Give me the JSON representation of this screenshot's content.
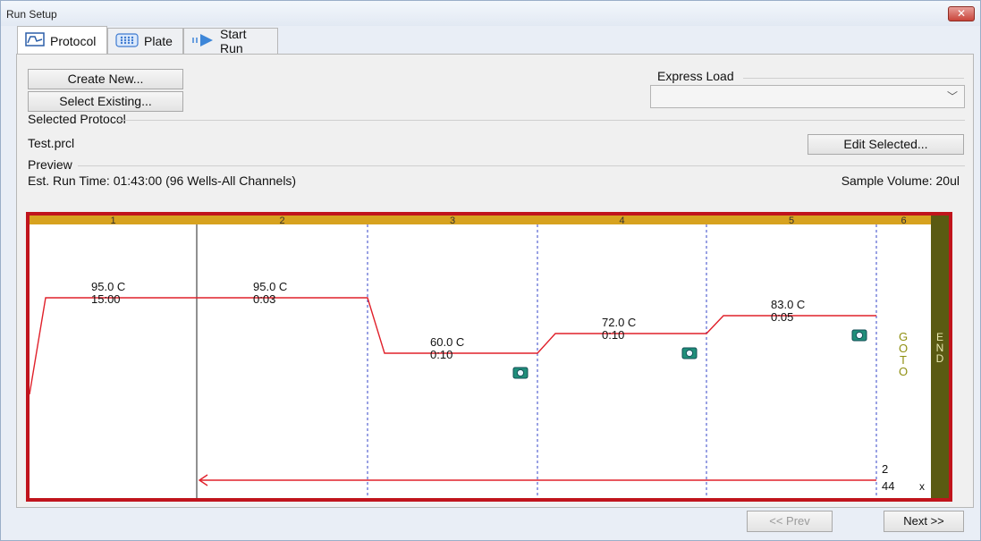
{
  "window": {
    "title": "Run Setup",
    "close_symbol": "✕"
  },
  "tabs": [
    {
      "label": "Protocol",
      "icon": "protocol-graph-icon",
      "selected": true
    },
    {
      "label": "Plate",
      "icon": "plate-grid-icon",
      "selected": false
    },
    {
      "label": "Start Run",
      "icon": "play-arrow-icon",
      "selected": false
    }
  ],
  "actions": {
    "create_new": "Create New...",
    "select_existing": "Select Existing...",
    "edit_selected": "Edit Selected..."
  },
  "express_load": {
    "label": "Express Load",
    "value": ""
  },
  "selected_protocol": {
    "label": "Selected Protocol",
    "name": "Test.prcl"
  },
  "preview": {
    "label": "Preview",
    "run_time": "Est. Run Time: 01:43:00  (96 Wells-All Channels)",
    "sample_volume": "Sample Volume: 20ul"
  },
  "protocol_chart": {
    "colors": {
      "header": "#d7a21f",
      "line": "#e0202a",
      "end_bar": "#5a5a12",
      "goto_text": "#8f8f10",
      "border": "#c0141c"
    },
    "steps": [
      {
        "number": "1",
        "temp": "95.0",
        "unit": "C",
        "time": "15:00",
        "plate_read": false
      },
      {
        "number": "2",
        "temp": "95.0",
        "unit": "C",
        "time": "0:03",
        "plate_read": false
      },
      {
        "number": "3",
        "temp": "60.0",
        "unit": "C",
        "time": "0:10",
        "plate_read": true
      },
      {
        "number": "4",
        "temp": "72.0",
        "unit": "C",
        "time": "0:10",
        "plate_read": true
      },
      {
        "number": "5",
        "temp": "83.0",
        "unit": "C",
        "time": "0:05",
        "plate_read": true
      }
    ],
    "goto": {
      "number": "6",
      "text": [
        "G",
        "O",
        "T",
        "O"
      ],
      "target_step": "2",
      "repeats": "44",
      "x_marker": "x"
    },
    "end": {
      "text": [
        "E",
        "N",
        "D"
      ]
    }
  },
  "navigation": {
    "prev": "<< Prev",
    "next": "Next >>"
  }
}
